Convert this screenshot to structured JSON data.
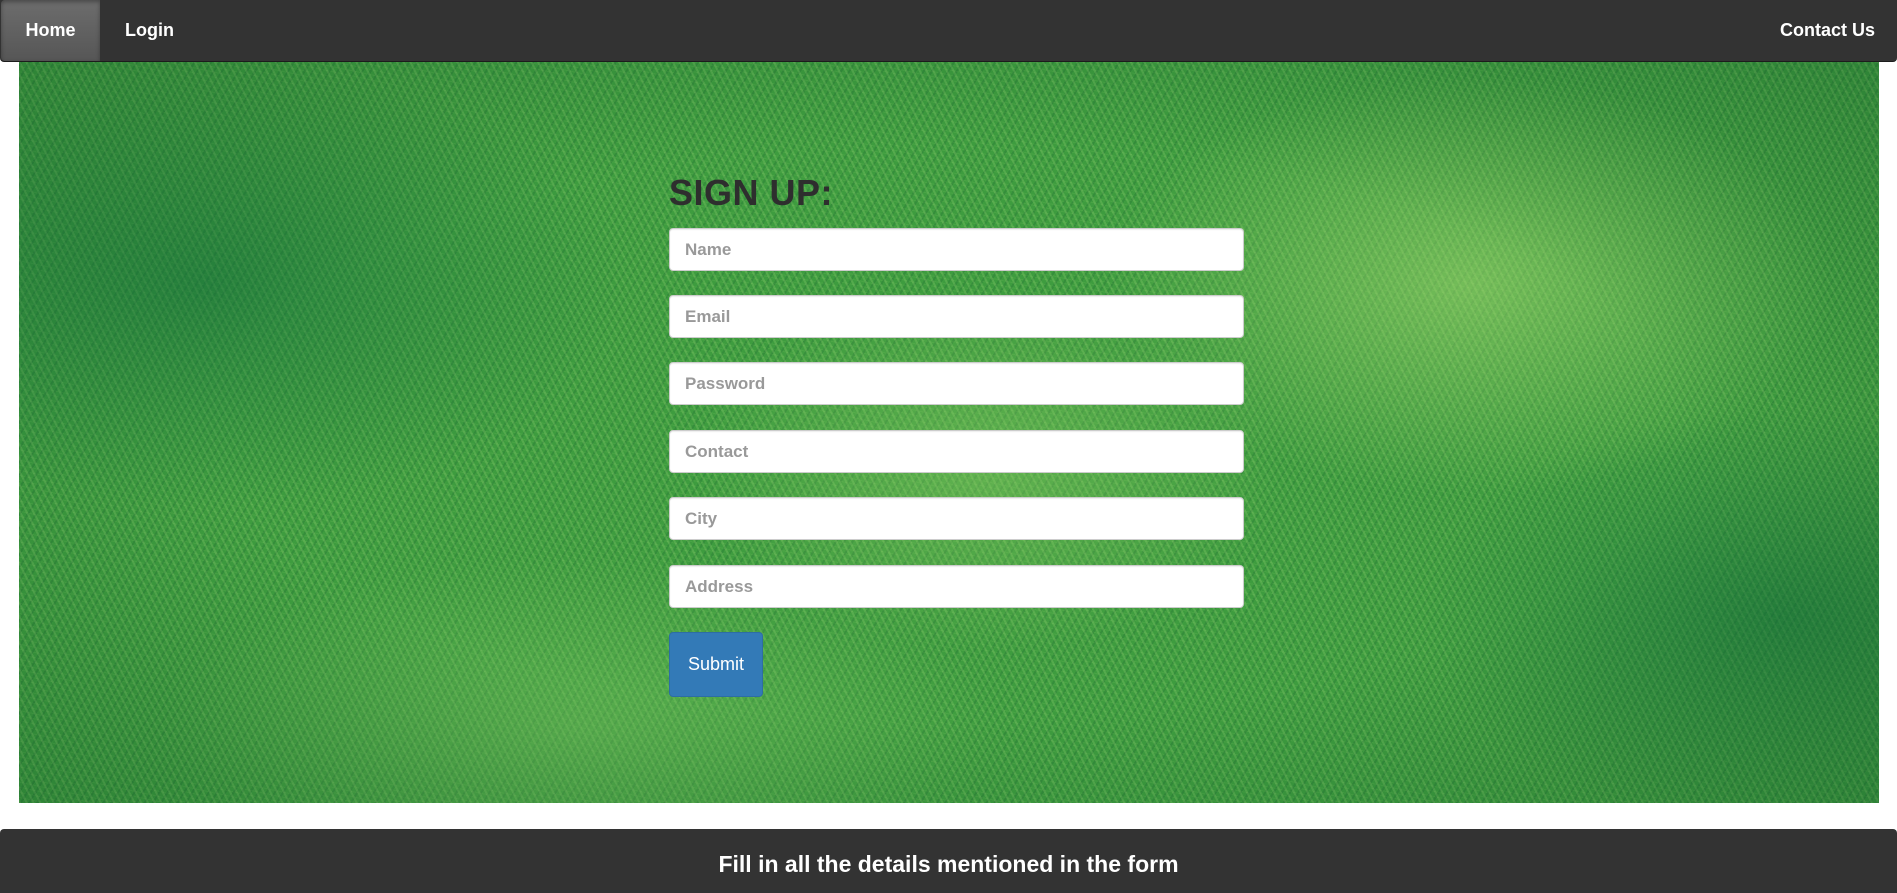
{
  "navbar": {
    "home_label": "Home",
    "login_label": "Login",
    "contact_label": "Contact Us",
    "background_color": "#333333",
    "active_item": "Home"
  },
  "hero": {
    "background": "grass texture",
    "base_color": "#3e9c3f"
  },
  "signup_form": {
    "title": "SIGN UP:",
    "fields": {
      "name": {
        "placeholder": "Name",
        "value": ""
      },
      "email": {
        "placeholder": "Email",
        "value": ""
      },
      "password": {
        "placeholder": "Password",
        "value": ""
      },
      "contact": {
        "placeholder": "Contact",
        "value": ""
      },
      "city": {
        "placeholder": "City",
        "value": ""
      },
      "address": {
        "placeholder": "Address",
        "value": ""
      }
    },
    "submit_label": "Submit",
    "submit_color": "#337ab7"
  },
  "footer": {
    "text": "Fill in all the details mentioned in the form",
    "background_color": "#333333"
  }
}
